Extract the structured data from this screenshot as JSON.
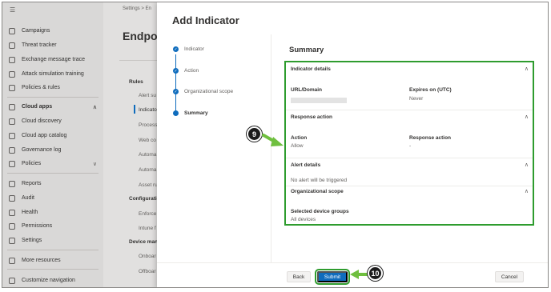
{
  "nav": {
    "items": [
      {
        "label": "Campaigns",
        "icon": "campaign-icon"
      },
      {
        "label": "Threat tracker",
        "icon": "tracker-icon"
      },
      {
        "label": "Exchange message trace",
        "icon": "exchange-icon"
      },
      {
        "label": "Attack simulation training",
        "icon": "simulation-icon"
      },
      {
        "label": "Policies & rules",
        "icon": "policies-icon"
      },
      {
        "label": "Cloud apps",
        "icon": "cloud-icon"
      },
      {
        "label": "Cloud discovery",
        "icon": "discovery-icon"
      },
      {
        "label": "Cloud app catalog",
        "icon": "catalog-icon"
      },
      {
        "label": "Governance log",
        "icon": "log-icon"
      },
      {
        "label": "Policies",
        "icon": "policy-icon"
      },
      {
        "label": "Reports",
        "icon": "reports-icon"
      },
      {
        "label": "Audit",
        "icon": "audit-icon"
      },
      {
        "label": "Health",
        "icon": "health-icon"
      },
      {
        "label": "Permissions",
        "icon": "permissions-icon"
      },
      {
        "label": "Settings",
        "icon": "settings-icon"
      },
      {
        "label": "More resources",
        "icon": "info-icon"
      },
      {
        "label": "Customize navigation",
        "icon": "edit-icon"
      }
    ]
  },
  "settings_page": {
    "breadcrumb": "Settings > En",
    "title": "Endpoi",
    "rules_header": "Rules",
    "rules_items": [
      "Alert su",
      "Indicato",
      "Process",
      "Web co",
      "Automa",
      "Automa",
      "Asset ru"
    ],
    "config_header": "Configuratio",
    "config_items": [
      "Enforce",
      "Intune f"
    ],
    "device_header": "Device man",
    "device_items": [
      "Onboar",
      "Offboar"
    ]
  },
  "modal": {
    "title": "Add Indicator",
    "steps": [
      {
        "label": "Indicator",
        "state": "done"
      },
      {
        "label": "Action",
        "state": "done"
      },
      {
        "label": "Organizational scope",
        "state": "done"
      },
      {
        "label": "Summary",
        "state": "current"
      }
    ],
    "summary_title": "Summary",
    "indicator_details": {
      "header": "Indicator details",
      "url_label": "URL/Domain",
      "expires_label": "Expires on (UTC)",
      "expires_value": "Never"
    },
    "response_action": {
      "header": "Response action",
      "action_label": "Action",
      "action_value": "Allow",
      "response_label": "Response action",
      "response_value": "-"
    },
    "alert_details": {
      "header": "Alert details",
      "value": "No alert will be triggered"
    },
    "org_scope": {
      "header": "Organizational scope",
      "groups_label": "Selected device groups",
      "groups_value": "All devices"
    },
    "buttons": {
      "back": "Back",
      "submit": "Submit",
      "cancel": "Cancel"
    }
  },
  "callouts": {
    "nine": "9",
    "ten": "10"
  },
  "colors": {
    "accent": "#0f6cbd",
    "highlight": "#2e9c2e",
    "callout": "#1b1b1b"
  }
}
